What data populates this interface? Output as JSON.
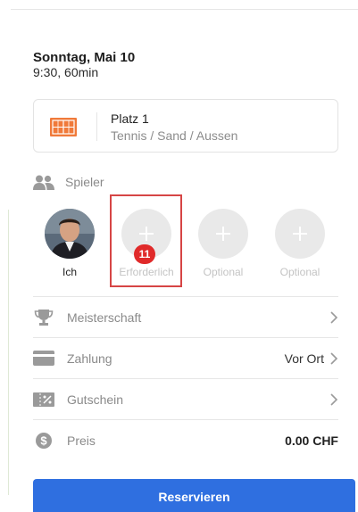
{
  "booking": {
    "date": "Sonntag, Mai 10",
    "time": "9:30, 60min"
  },
  "court": {
    "name": "Platz 1",
    "description": "Tennis / Sand / Aussen",
    "icon": "tennis-court-icon",
    "icon_color": "#f07a3a"
  },
  "players": {
    "heading": "Spieler",
    "slots": [
      {
        "label": "Ich",
        "filled": true
      },
      {
        "label": "Erforderlich",
        "filled": false
      },
      {
        "label": "Optional",
        "filled": false
      },
      {
        "label": "Optional",
        "filled": false
      }
    ],
    "badge_count": "11"
  },
  "rows": [
    {
      "label": "Meisterschaft",
      "value": "",
      "icon": "trophy-icon"
    },
    {
      "label": "Zahlung",
      "value": "Vor Ort",
      "icon": "card-icon"
    },
    {
      "label": "Gutschein",
      "value": "",
      "icon": "voucher-icon"
    },
    {
      "label": "Preis",
      "value": "0.00 CHF",
      "icon": "dollar-icon"
    }
  ],
  "actions": {
    "reserve_label": "Reservieren"
  },
  "colors": {
    "primary": "#2f6fe0",
    "highlight": "#d64545",
    "badge": "#e02a2a"
  }
}
